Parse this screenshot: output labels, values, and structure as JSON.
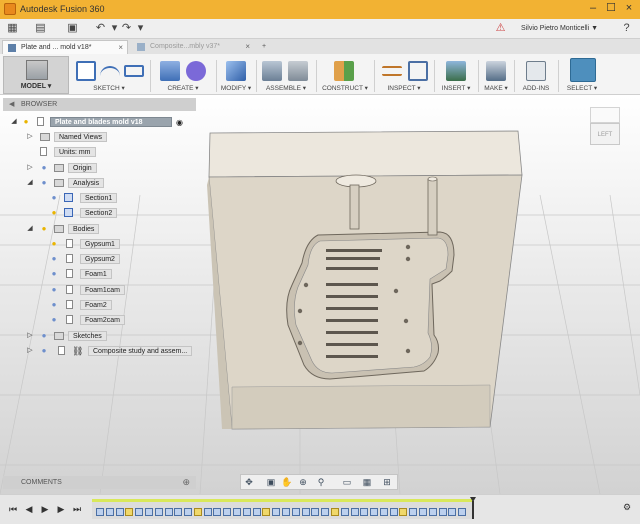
{
  "window": {
    "title": "Autodesk Fusion 360",
    "controls": [
      "minimize-icon",
      "maximize-icon",
      "close-icon"
    ]
  },
  "quickbar": {
    "user": "Silvio Pietro Monticelli ▼",
    "icons": [
      "grid-icon",
      "file-icon",
      "save-icon",
      "undo-icon",
      "redo-icon",
      "alert-icon",
      "help-icon"
    ]
  },
  "tabs": [
    {
      "label": "Plate and ... mold v18*",
      "active": true
    },
    {
      "label": "Composite...mbly v37*",
      "active": false
    }
  ],
  "toolbar": {
    "workspace": "MODEL ▾",
    "groups": [
      {
        "label": "SKETCH ▾",
        "color": "#3f6fb6"
      },
      {
        "label": "CREATE ▾",
        "color": "#6b58c8"
      },
      {
        "label": "MODIFY ▾",
        "color": "#3f6fb6"
      },
      {
        "label": "ASSEMBLE ▾",
        "color": "#6b7f95"
      },
      {
        "label": "CONSTRUCT ▾",
        "color": "#c0762a"
      },
      {
        "label": "INSPECT ▾",
        "color": "#4b6fa4"
      },
      {
        "label": "INSERT ▾",
        "color": "#4b7ba9"
      },
      {
        "label": "MAKE ▾",
        "color": "#546d87"
      },
      {
        "label": "ADD-INS",
        "color": "#6e7d8c"
      },
      {
        "label": "SELECT ▾",
        "color": "#2e8b6e"
      }
    ]
  },
  "browser": {
    "title": "BROWSER",
    "rows": [
      {
        "label": "Plate and blades mold v18",
        "kind": "root"
      },
      {
        "label": "Named Views",
        "kind": "folder"
      },
      {
        "label": "Units: mm",
        "kind": "doc"
      },
      {
        "label": "Origin",
        "kind": "folder"
      },
      {
        "label": "Analysis",
        "kind": "folder"
      },
      {
        "label": "Section1",
        "kind": "section"
      },
      {
        "label": "Section2",
        "kind": "section"
      },
      {
        "label": "Bodies",
        "kind": "folder"
      },
      {
        "label": "Gypsum1",
        "kind": "body"
      },
      {
        "label": "Gypsum2",
        "kind": "body"
      },
      {
        "label": "Foam1",
        "kind": "body"
      },
      {
        "label": "Foam1cam",
        "kind": "body"
      },
      {
        "label": "Foam2",
        "kind": "body"
      },
      {
        "label": "Foam2cam",
        "kind": "body"
      },
      {
        "label": "Sketches",
        "kind": "folder"
      },
      {
        "label": "Composite study and assem...",
        "kind": "link"
      }
    ]
  },
  "viewcube": {
    "face": "LEFT"
  },
  "comments": {
    "title": "COMMENTS"
  },
  "navbar": {
    "icons": [
      "orbit-icon",
      "pan-hand-icon",
      "look-at-icon",
      "zoom-icon",
      "fit-icon",
      "display-icon",
      "grid-icon",
      "viewports-icon"
    ]
  },
  "timeline": {
    "controls": [
      "first-icon",
      "previous-icon",
      "play-icon",
      "next-icon",
      "last-icon"
    ],
    "item_count": 38
  }
}
